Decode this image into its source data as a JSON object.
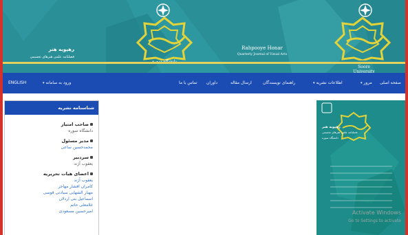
{
  "banner": {
    "university_fa": "دانشگاه سوره",
    "university_en": "Soore University",
    "journal_title_fa": "رهپویه هنر",
    "journal_subtitle_fa": "فصلنامه علمی هنرهای تجسمی",
    "journal_title_en": "Rahpooye Honar",
    "journal_subtitle_en": "Quarterly Journal of Visual Arts"
  },
  "nav": {
    "english": "ENGLISH",
    "login": "ورود به سامانه",
    "home": "صفحه اصلی",
    "browse": "مرور",
    "journal_info": "اطلاعات نشریه",
    "author_guide": "راهنمای نویسندگان",
    "submit": "ارسال مقاله",
    "reviewers": "داوران",
    "contact": "تماس با ما"
  },
  "sidebar": {
    "header": "شناسنامه نشریه",
    "sections": [
      {
        "title": "صاحب امتیاز",
        "values": [
          "دانشگاه سوره"
        ],
        "link": false
      },
      {
        "title": "مدیر مسئول",
        "values": [
          "محمدحسین ساعی"
        ],
        "link": true
      },
      {
        "title": "سردبیر",
        "values": [
          "یعقوب آژند"
        ],
        "link": false
      },
      {
        "title": "اعضای هیات تحریریه",
        "values": [
          "یعقوب آژند",
          "کامران افشار مهاجر",
          "مهناز الشهابی سیادتی قوسی",
          "اسماعیل بنی اردلان",
          "غلامعلی حاتم",
          "امیرحسین مسعودی"
        ],
        "link": true
      }
    ]
  },
  "cover": {
    "title": "رهپویه هنر",
    "subtitle": "فصلنامه علمی هنرهای تجسمی",
    "university": "دانشگاه سوره"
  },
  "watermark": {
    "line1": "Activate Windows",
    "line2": "Go to Settings to activate"
  },
  "colors": {
    "frame": "#d4322b",
    "banner": "#2b8f98",
    "nav": "#1b4cb3",
    "logo_gold": "#e3d33b"
  }
}
